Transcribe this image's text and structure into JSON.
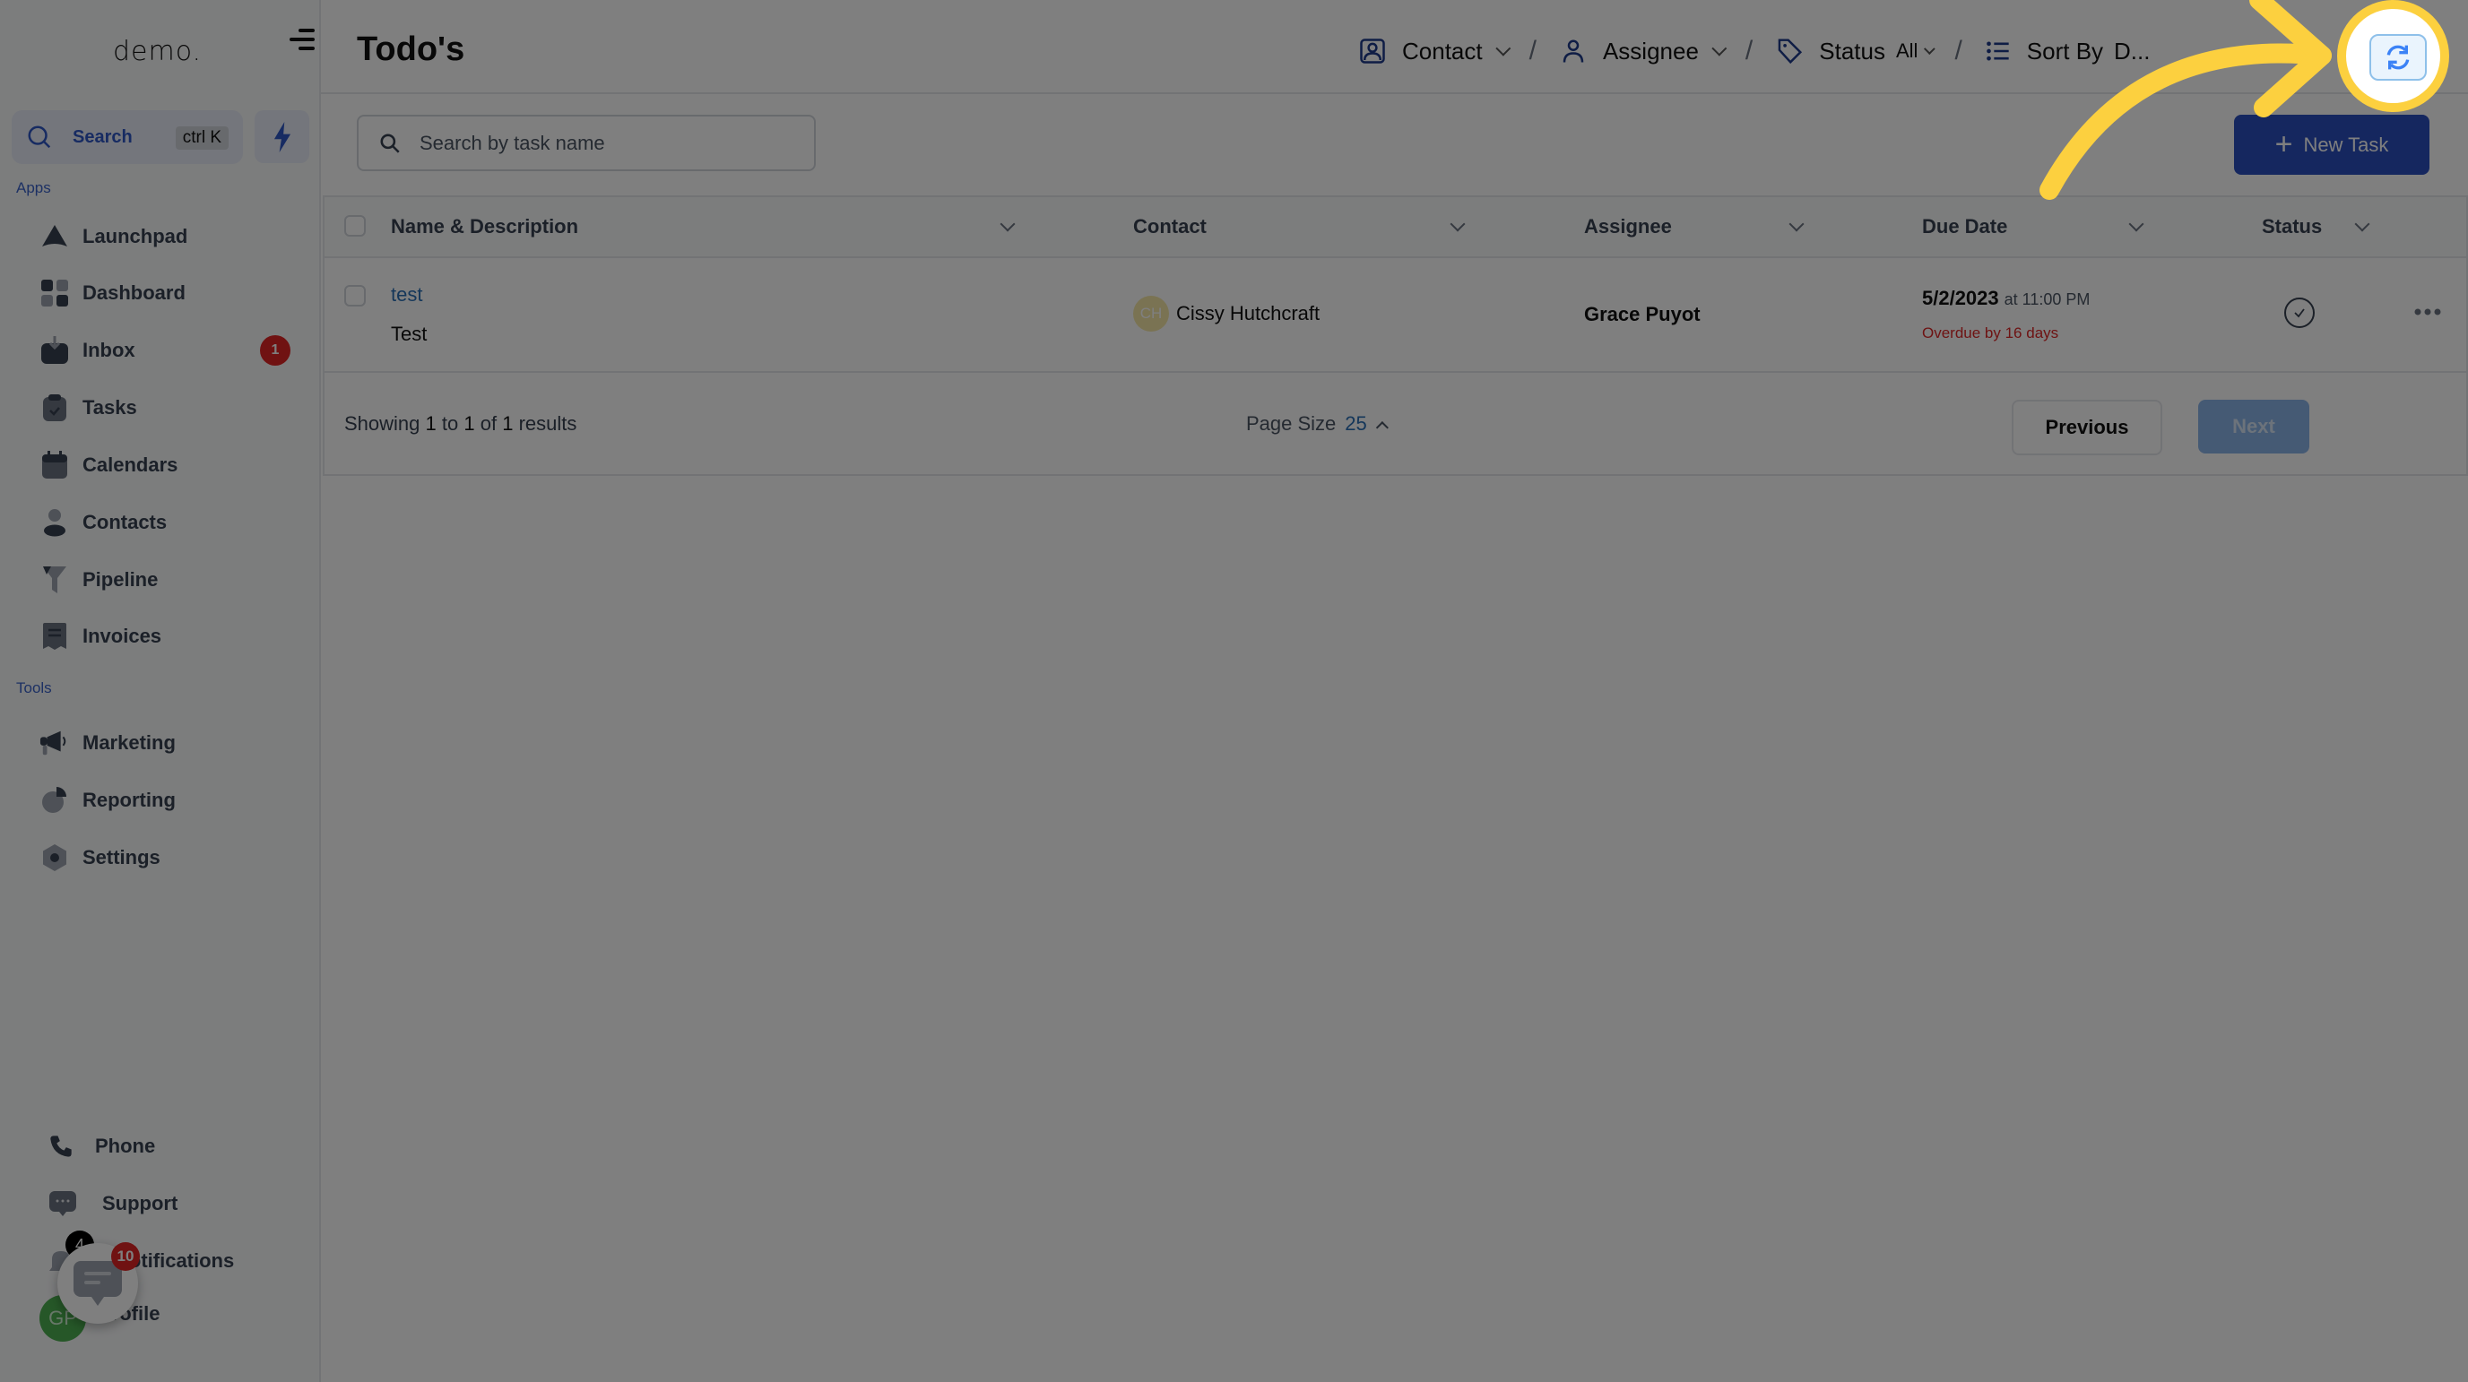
{
  "sidebar": {
    "logo": "demo.",
    "search_label": "Search",
    "search_shortcut": "ctrl K",
    "apps_label": "Apps",
    "tools_label": "Tools",
    "apps": [
      {
        "label": "Launchpad",
        "icon": "rocket-icon"
      },
      {
        "label": "Dashboard",
        "icon": "grid-icon"
      },
      {
        "label": "Inbox",
        "icon": "inbox-icon",
        "badge": "1"
      },
      {
        "label": "Tasks",
        "icon": "clipboard-check-icon"
      },
      {
        "label": "Calendars",
        "icon": "calendar-icon"
      },
      {
        "label": "Contacts",
        "icon": "person-icon"
      },
      {
        "label": "Pipeline",
        "icon": "funnel-icon"
      },
      {
        "label": "Invoices",
        "icon": "receipt-icon"
      }
    ],
    "tools": [
      {
        "label": "Marketing",
        "icon": "megaphone-icon"
      },
      {
        "label": "Reporting",
        "icon": "pie-chart-icon"
      },
      {
        "label": "Settings",
        "icon": "gear-icon"
      }
    ],
    "bottom": [
      {
        "label": "Phone",
        "icon": "phone-icon"
      },
      {
        "label": "Support",
        "icon": "chat-icon"
      },
      {
        "label": "Notifications",
        "icon": "bell-icon",
        "badge": "4"
      },
      {
        "label": "Profile",
        "initials": "GP"
      }
    ],
    "chat_widget_badge": "10"
  },
  "header": {
    "title": "Todo's",
    "filters": {
      "contact": "Contact",
      "assignee": "Assignee",
      "status": "Status",
      "status_value": "All",
      "sort_by": "Sort By",
      "sort_value": "D..."
    },
    "separator": "/"
  },
  "toolbar": {
    "search_placeholder": "Search by task name",
    "new_task_label": "New Task"
  },
  "table": {
    "columns": [
      "Name & Description",
      "Contact",
      "Assignee",
      "Due Date",
      "Status"
    ],
    "rows": [
      {
        "name": "test",
        "description": "Test",
        "contact_initials": "CH",
        "contact": "Cissy Hutchcraft",
        "assignee": "Grace Puyot",
        "due_date": "5/2/2023",
        "due_time": "at 11:00 PM",
        "overdue": "Overdue by 16 days"
      }
    ]
  },
  "pagination": {
    "showing_prefix": "Showing",
    "from": "1",
    "to_word": "to",
    "to": "1",
    "of_word": "of",
    "total": "1",
    "results_word": "results",
    "page_size_label": "Page Size",
    "page_size": "25",
    "previous_label": "Previous",
    "next_label": "Next"
  },
  "colors": {
    "accent": "#2a4fbe",
    "link": "#2a6fb5",
    "overdue": "#dc2626",
    "highlight": "#fcd03f"
  }
}
